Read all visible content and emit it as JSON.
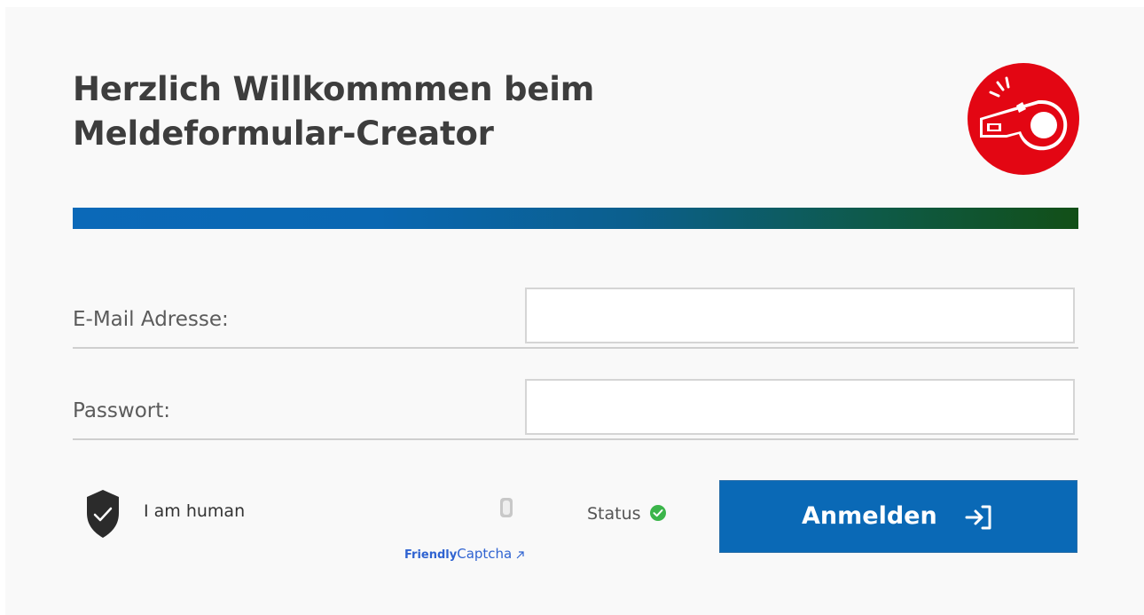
{
  "page": {
    "title_line1": "Herzlich Willkommmen beim",
    "title_line2": "Meldeformular-Creator"
  },
  "logo": {
    "icon": "whistle-icon",
    "color": "#e30613"
  },
  "divider": {
    "colors": [
      "#0b69b8",
      "#124f17"
    ]
  },
  "form": {
    "email_label": "E-Mail Adresse:",
    "email_value": "",
    "password_label": "Passwort:",
    "password_value": ""
  },
  "captcha": {
    "label": "I am human",
    "brand_bold": "Friendly",
    "brand_rest": "Captcha",
    "brand_icon": "external-link-icon",
    "shield_icon": "shield-check-icon"
  },
  "status": {
    "label": "Status",
    "icon": "check-circle-icon",
    "color": "#3bb54a"
  },
  "login": {
    "label": "Anmelden",
    "icon": "login-arrow-icon",
    "color": "#0a69b6"
  }
}
